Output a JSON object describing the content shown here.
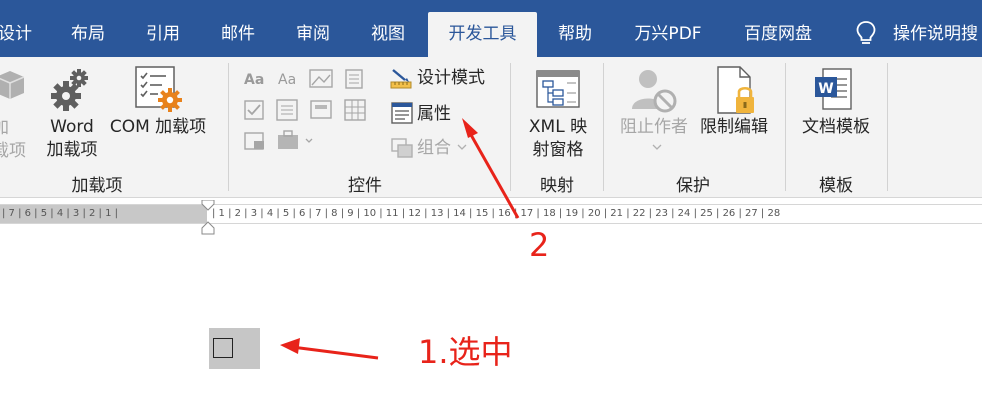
{
  "tabs": [
    {
      "label": "设计"
    },
    {
      "label": "布局"
    },
    {
      "label": "引用"
    },
    {
      "label": "邮件"
    },
    {
      "label": "审阅"
    },
    {
      "label": "视图"
    },
    {
      "label": "开发工具"
    },
    {
      "label": "帮助"
    },
    {
      "label": "万兴PDF"
    },
    {
      "label": "百度网盘"
    }
  ],
  "tell_me": {
    "label": "操作说明搜",
    "icon": "lightbulb-icon"
  },
  "groups": {
    "addins": {
      "label": "加载项",
      "partial_label": "加\n载项",
      "word_addins": "Word\n加载项",
      "com_addins": "COM 加载项"
    },
    "controls": {
      "label": "控件",
      "design_mode": "设计模式",
      "properties": "属性",
      "group": "组合"
    },
    "mapping": {
      "label": "映射",
      "xml_pane": "XML 映\n射窗格"
    },
    "protect": {
      "label": "保护",
      "block_authors": "阻止作者",
      "restrict_editing": "限制编辑"
    },
    "templates": {
      "label": "模板",
      "doc_template": "文档模板"
    }
  },
  "ruler": {
    "left_text": "| 7 | 6 | 5 | 4 | 3 | 2 | 1 |",
    "right_text": "| 1 | 2 | 3 | 4 | 5 | 6 | 7 | 8 | 9 | 10 | 11 | 12 | 13 | 14 | 15 | 16 | 17 | 18 | 19 | 20 | 21 | 22 | 23 | 24 | 25 | 26 | 27 | 28"
  },
  "document": {
    "checkbox_glyph": "☐"
  },
  "annotations": {
    "select": "1.选中",
    "step2": "2"
  },
  "colors": {
    "tab_bar": "#2b579a",
    "ribbon": "#f3f3f3",
    "annotation": "#e8231a",
    "selection": "#c6c6c6"
  }
}
